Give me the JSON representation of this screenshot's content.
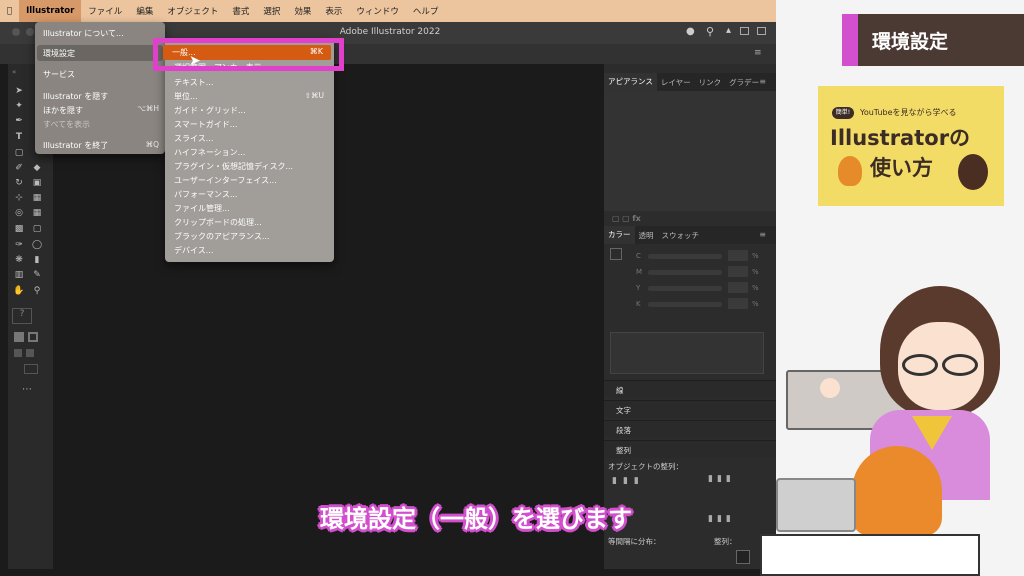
{
  "mac_menubar": {
    "items": [
      "Illustrator",
      "ファイル",
      "編集",
      "オブジェクト",
      "書式",
      "選択",
      "効果",
      "表示",
      "ウィンドウ",
      "ヘルプ"
    ]
  },
  "window_title": "Adobe Illustrator 2022",
  "app_menu": {
    "items": [
      {
        "label": "Illustrator について...",
        "shortcut": ""
      },
      {
        "label": "環境設定",
        "shortcut": ""
      },
      {
        "label": "サービス",
        "shortcut": ""
      },
      {
        "label": "Illustrator を隠す",
        "shortcut": "⌥⌘H"
      },
      {
        "label": "ほかを隠す",
        "shortcut": "⌥⌘H"
      },
      {
        "label": "すべてを表示",
        "shortcut": ""
      },
      {
        "label": "Illustrator を終了",
        "shortcut": "⌘Q"
      }
    ]
  },
  "prefs_menu": {
    "highlighted": {
      "label": "一般...",
      "shortcut": "⌘K"
    },
    "items": [
      {
        "label": "選択範囲・アンカー表示...",
        "shortcut": ""
      },
      {
        "label": "テキスト...",
        "shortcut": ""
      },
      {
        "label": "単位...",
        "shortcut": "⇧⌘U"
      },
      {
        "label": "ガイド・グリッド...",
        "shortcut": ""
      },
      {
        "label": "スマートガイド...",
        "shortcut": ""
      },
      {
        "label": "スライス...",
        "shortcut": ""
      },
      {
        "label": "ハイフネーション...",
        "shortcut": ""
      },
      {
        "label": "プラグイン・仮想記憶ディスク...",
        "shortcut": ""
      },
      {
        "label": "ユーザーインターフェイス...",
        "shortcut": ""
      },
      {
        "label": "パフォーマンス...",
        "shortcut": ""
      },
      {
        "label": "ファイル管理...",
        "shortcut": ""
      },
      {
        "label": "クリップボードの処理...",
        "shortcut": ""
      },
      {
        "label": "ブラックのアピアランス...",
        "shortcut": ""
      },
      {
        "label": "デバイス...",
        "shortcut": ""
      }
    ]
  },
  "panels": {
    "appearance_tabs": [
      "アピアランス",
      "レイヤー",
      "リンク",
      "グラデー"
    ],
    "color_tabs": [
      "カラー",
      "透明",
      "スウォッチ"
    ],
    "cmyk": [
      "C",
      "M",
      "Y",
      "K"
    ],
    "pct": "%",
    "rows": [
      "線",
      "文字",
      "段落",
      "整列"
    ],
    "align_label": "オブジェクトの整列：",
    "distribute_label": "等間隔に分布：",
    "align_to_label": "整列："
  },
  "right": {
    "tag": "環境設定",
    "book_pill": "簡単!",
    "book_sub": "YouTubeを見ながら学べる",
    "book_title1": "Illustratorの",
    "book_title2": "使い方"
  },
  "subtitle": "環境設定（一般）を選びます",
  "colors": {
    "accent": "#d24fcd",
    "highlight": "#d55a12",
    "menubar": "#ecc59f"
  }
}
